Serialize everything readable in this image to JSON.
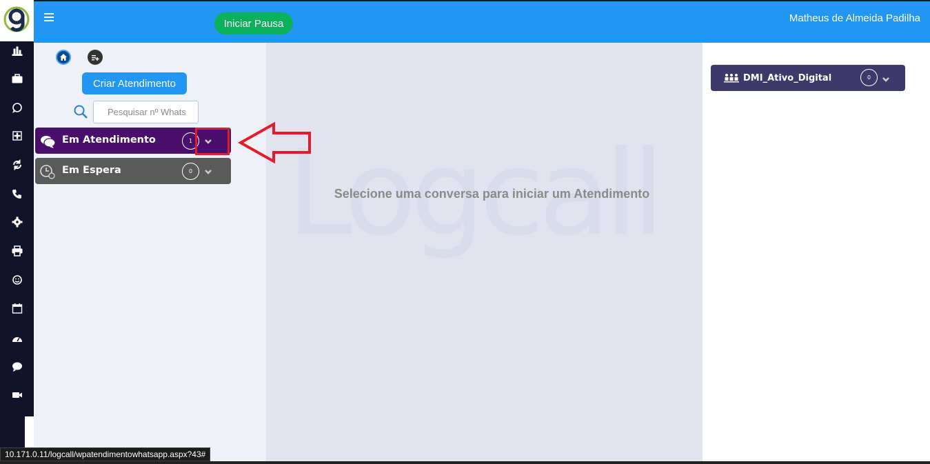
{
  "topbar": {
    "pause_button": "Iniciar Pausa",
    "user_name": "Matheus de Almeida Padilha"
  },
  "sidebar": {
    "icons": [
      "bar-chart-icon",
      "briefcase-icon",
      "whatsapp-icon",
      "plus-square-icon",
      "refresh-icon",
      "phone-icon",
      "gear-icon",
      "printer-icon",
      "smiley-icon",
      "calendar-icon",
      "dashboard-icon",
      "chat-bubble-icon",
      "video-camera-icon"
    ]
  },
  "leftpanel": {
    "create_button": "Criar Atendimento",
    "search_placeholder": "Pesquisar nº Whats",
    "queues": [
      {
        "label": "Em Atendimento",
        "count": "1",
        "color": "#4a0f6b"
      },
      {
        "label": "Em Espera",
        "count": "0",
        "color": "#5a5a5a"
      }
    ]
  },
  "center": {
    "message": "Selecione uma conversa para iniciar um Atendimento"
  },
  "rightpanel": {
    "campaign_label": "DMI_Ativo_Digital",
    "campaign_count": "0"
  },
  "statusbar": {
    "url": "10.171.0.11/logcall/wpatendimentowhatsapp.aspx?43#"
  },
  "colors": {
    "topbar": "#2196f3",
    "rail": "#13122b",
    "pause_button": "#0bb05a",
    "annotation": "#e21d2b"
  }
}
